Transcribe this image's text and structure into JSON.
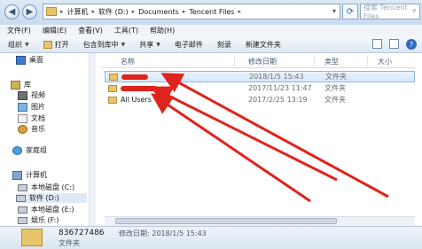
{
  "address": {
    "segments": [
      "计算机",
      "软件 (D:)",
      "Documents",
      "Tencent Files"
    ],
    "search_placeholder": "搜索 Tencent Files"
  },
  "menu": [
    "文件(F)",
    "编辑(E)",
    "查看(V)",
    "工具(T)",
    "帮助(H)"
  ],
  "toolbar": {
    "organize": "组织",
    "open": "打开",
    "include_library": "包含到库中",
    "share": "共享",
    "email": "电子邮件",
    "burn": "刻录",
    "new_folder": "新建文件夹"
  },
  "nav": {
    "desktop": "桌面",
    "libraries": "库",
    "videos": "视频",
    "pictures": "图片",
    "documents": "文档",
    "music": "音乐",
    "homegroup": "家庭组",
    "computer": "计算机",
    "drives": [
      "本地磁盘 (C:)",
      "软件 (D:)",
      "本地磁盘 (E:)",
      "娱乐 (F:)"
    ]
  },
  "columns": {
    "name": "名称",
    "modified": "修改日期",
    "type": "类型",
    "size": "大小"
  },
  "files": [
    {
      "name": "",
      "redacted": true,
      "modified": "2018/1/5 15:43",
      "type": "文件夹"
    },
    {
      "name": "",
      "redacted": true,
      "modified": "2017/11/23 11:47",
      "type": "文件夹"
    },
    {
      "name": "All Users",
      "redacted": false,
      "modified": "2017/2/25 13:19",
      "type": "文件夹"
    }
  ],
  "details": {
    "name": "836727486",
    "modified_label": "修改日期: 2018/1/5 15:43",
    "type": "文件夹"
  },
  "annotation_color": "#e0231c"
}
